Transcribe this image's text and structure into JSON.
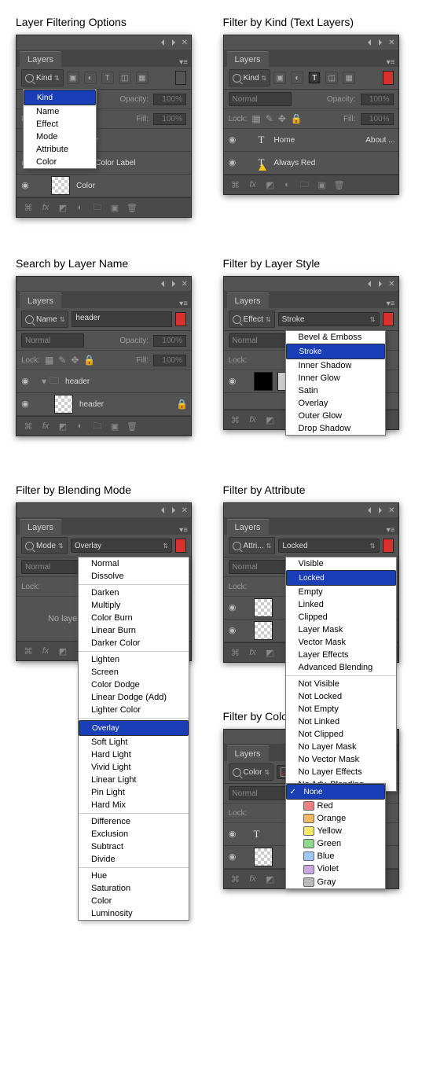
{
  "panels": {
    "p1": {
      "caption": "Layer Filtering Options",
      "tab": "Layers",
      "filterLabel": "Kind",
      "blendLabel": "",
      "opacityLabel": "Opacity:",
      "opacityVal": "100%",
      "lockLabel": "Lock:",
      "fillLabel": "Fill:",
      "fillVal": "100%",
      "dd": [
        "Kind",
        "Name",
        "Effect",
        "Mode",
        "Attribute",
        "Color"
      ],
      "ddSelected": "Kind",
      "layers": [
        {
          "name": "Color",
          "type": "solid"
        },
        {
          "name": "Filter by Color Label",
          "type": "text"
        },
        {
          "name": "Color",
          "type": "chk"
        }
      ]
    },
    "p2": {
      "caption": "Filter by Kind (Text Layers)",
      "tab": "Layers",
      "filterLabel": "Kind",
      "blendLabel": "Normal",
      "opacityLabel": "Opacity:",
      "opacityVal": "100%",
      "lockLabel": "Lock:",
      "fillLabel": "Fill:",
      "fillVal": "100%",
      "layers": [
        {
          "name": "Home",
          "name2": "About ...",
          "type": "text"
        },
        {
          "name": "Always Red",
          "type": "textwarn"
        }
      ]
    },
    "p3": {
      "caption": "Search by Layer Name",
      "tab": "Layers",
      "filterLabel": "Name",
      "searchValue": "header",
      "blendLabel": "Normal",
      "opacityLabel": "Opacity:",
      "opacityVal": "100%",
      "lockLabel": "Lock:",
      "fillLabel": "Fill:",
      "fillVal": "100%",
      "layers": [
        {
          "name": "header",
          "type": "folder"
        },
        {
          "name": "header",
          "type": "chk",
          "locked": true
        }
      ]
    },
    "p4": {
      "caption": "Filter by Layer Style",
      "tab": "Layers",
      "filterLabel": "Effect",
      "selectVal": "Stroke",
      "blendLabel": "Normal",
      "lockLabel": "Lock:",
      "dd": [
        "Bevel & Emboss",
        "Stroke",
        "Inner Shadow",
        "Inner Glow",
        "Satin",
        "Overlay",
        "Outer Glow",
        "Drop Shadow"
      ],
      "ddSelected": "Stroke",
      "layers": [
        {
          "name": "",
          "type": "shape"
        }
      ]
    },
    "p5": {
      "caption": "Filter by Blending Mode",
      "tab": "Layers",
      "filterLabel": "Mode",
      "selectVal": "Overlay",
      "blendLabel": "Normal",
      "lockLabel": "Lock:",
      "emptyMsg": "No laye",
      "dd": [
        [
          "Normal",
          "Dissolve"
        ],
        [
          "Darken",
          "Multiply",
          "Color Burn",
          "Linear Burn",
          "Darker Color"
        ],
        [
          "Lighten",
          "Screen",
          "Color Dodge",
          "Linear Dodge (Add)",
          "Lighter Color"
        ],
        [
          "Overlay",
          "Soft Light",
          "Hard Light",
          "Vivid Light",
          "Linear Light",
          "Pin Light",
          "Hard Mix"
        ],
        [
          "Difference",
          "Exclusion",
          "Subtract",
          "Divide"
        ],
        [
          "Hue",
          "Saturation",
          "Color",
          "Luminosity"
        ]
      ],
      "ddSelected": "Overlay"
    },
    "p6": {
      "caption": "Filter by Attribute",
      "tab": "Layers",
      "filterLabel": "Attri...",
      "selectVal": "Locked",
      "blendLabel": "Normal",
      "lockLabel": "Lock:",
      "dd": [
        [
          "Visible",
          "Locked",
          "Empty",
          "Linked",
          "Clipped",
          "Layer Mask",
          "Vector Mask",
          "Layer Effects",
          "Advanced Blending"
        ],
        [
          "Not Visible",
          "Not Locked",
          "Not Empty",
          "Not Linked",
          "Not Clipped",
          "No Layer Mask",
          "No Vector Mask",
          "No Layer Effects",
          "No Adv. Blending"
        ]
      ],
      "ddSelected": "Locked",
      "layers": [
        {
          "name": "",
          "type": "chk"
        },
        {
          "name": "",
          "type": "chk"
        }
      ]
    },
    "p7": {
      "caption": "Filter by Color Label",
      "tab": "Layers",
      "filterLabel": "Color",
      "selectVal": "None",
      "blendLabel": "Normal",
      "lockLabel": "Lock:",
      "dd": [
        {
          "label": "None",
          "color": null,
          "checked": true
        },
        {
          "label": "Red",
          "color": "#f08080"
        },
        {
          "label": "Orange",
          "color": "#f4b860"
        },
        {
          "label": "Yellow",
          "color": "#f5e96a"
        },
        {
          "label": "Green",
          "color": "#8fd98f"
        },
        {
          "label": "Blue",
          "color": "#9cc8f5"
        },
        {
          "label": "Violet",
          "color": "#c8a8e0"
        },
        {
          "label": "Gray",
          "color": "#bababa"
        }
      ],
      "layers": [
        {
          "name": "",
          "type": "text"
        },
        {
          "name": "",
          "type": "chk"
        }
      ]
    }
  }
}
